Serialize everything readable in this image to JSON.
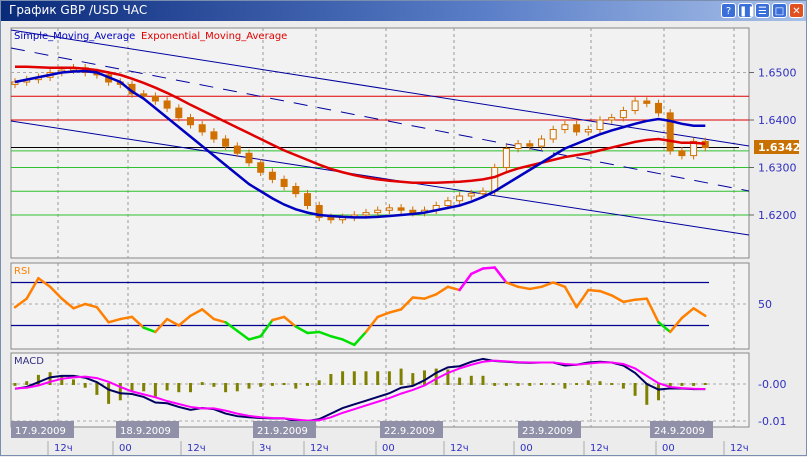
{
  "window": {
    "title": "График GBP /USD  ЧАС",
    "buttons": [
      "?",
      "❚❚",
      "☰",
      "□",
      "✕"
    ]
  },
  "colors": {
    "candle": "#d07000",
    "sma": "#0000c0",
    "ema": "#e00000",
    "rsi": "#ff8000",
    "rsi_high": "#ff00ff",
    "rsi_low": "#00e000",
    "macd": "#000060",
    "signal": "#ff00ff",
    "hist": "#808000",
    "current_bg": "#c87000"
  },
  "chart_data": [
    {
      "type": "candlestick",
      "title": "GBP/USD",
      "legend": [
        "Simple_Moving_Average",
        "Exponential_Moving_Average"
      ],
      "y_ticks": [
        "1.6500",
        "1.6400",
        "1.6300",
        "1.6200"
      ],
      "y_tick_values": [
        1.65,
        1.64,
        1.63,
        1.62
      ],
      "current_price": "1.6342",
      "current_value": 1.6342,
      "red_levels": [
        1.645,
        1.64
      ],
      "green_levels": [
        1.6335,
        1.63,
        1.625,
        1.62
      ],
      "closes": [
        1.648,
        1.6485,
        1.649,
        1.65,
        1.6505,
        1.651,
        1.65,
        1.6495,
        1.648,
        1.6475,
        1.6455,
        1.645,
        1.644,
        1.6425,
        1.6405,
        1.639,
        1.6375,
        1.636,
        1.6345,
        1.633,
        1.631,
        1.629,
        1.6275,
        1.626,
        1.6245,
        1.622,
        1.6195,
        1.619,
        1.6195,
        1.62,
        1.6205,
        1.621,
        1.6215,
        1.621,
        1.6205,
        1.621,
        1.622,
        1.623,
        1.624,
        1.6245,
        1.625,
        1.63,
        1.634,
        1.635,
        1.6345,
        1.636,
        1.638,
        1.639,
        1.6375,
        1.638,
        1.64,
        1.6405,
        1.642,
        1.644,
        1.6435,
        1.6415,
        1.6335,
        1.6325,
        1.6355,
        1.6342
      ],
      "sma": [
        1.648,
        1.6485,
        1.649,
        1.6495,
        1.65,
        1.6502,
        1.6503,
        1.65,
        1.649,
        1.648,
        1.646,
        1.6445,
        1.6425,
        1.6405,
        1.6385,
        1.6365,
        1.6345,
        1.6325,
        1.6305,
        1.6285,
        1.6265,
        1.625,
        1.6235,
        1.6222,
        1.6212,
        1.6205,
        1.62,
        1.6198,
        1.6196,
        1.6195,
        1.6195,
        1.6196,
        1.6198,
        1.62,
        1.6202,
        1.6205,
        1.621,
        1.6215,
        1.622,
        1.6228,
        1.6238,
        1.625,
        1.6265,
        1.628,
        1.6295,
        1.631,
        1.6325,
        1.634,
        1.635,
        1.636,
        1.637,
        1.6378,
        1.6385,
        1.6392,
        1.6398,
        1.6402,
        1.6398,
        1.6392,
        1.6388,
        1.6388
      ],
      "ema": [
        1.6512,
        1.6512,
        1.6511,
        1.651,
        1.651,
        1.651,
        1.6508,
        1.6505,
        1.65,
        1.6495,
        1.6487,
        1.6478,
        1.6468,
        1.6457,
        1.6445,
        1.6432,
        1.642,
        1.6408,
        1.6396,
        1.6384,
        1.6372,
        1.636,
        1.6348,
        1.6336,
        1.6326,
        1.6316,
        1.6306,
        1.6297,
        1.629,
        1.6284,
        1.6279,
        1.6275,
        1.6272,
        1.627,
        1.6268,
        1.6268,
        1.6268,
        1.6269,
        1.627,
        1.6272,
        1.6275,
        1.628,
        1.629,
        1.6298,
        1.6304,
        1.631,
        1.6316,
        1.6322,
        1.6326,
        1.633,
        1.6336,
        1.6342,
        1.6348,
        1.6354,
        1.6358,
        1.636,
        1.6356,
        1.6352,
        1.6352,
        1.635
      ]
    },
    {
      "type": "line",
      "title": "RSI",
      "y_ticks": [
        "50"
      ],
      "levels": [
        70,
        30
      ],
      "values": [
        47,
        55,
        74,
        66,
        55,
        46,
        50,
        47,
        33,
        36,
        38,
        28,
        24,
        36,
        30,
        39,
        45,
        36,
        33,
        25,
        17,
        20,
        35,
        38,
        29,
        23,
        24,
        20,
        17,
        12,
        24,
        38,
        42,
        45,
        56,
        55,
        59,
        66,
        63,
        78,
        83,
        84,
        70,
        66,
        64,
        66,
        70,
        66,
        47,
        63,
        62,
        58,
        52,
        54,
        55,
        33,
        24,
        37,
        46,
        39
      ]
    },
    {
      "type": "line",
      "title": "MACD",
      "y_ticks": [
        "-0.00",
        "-0.01"
      ],
      "main": [
        -0.0013,
        -0.0008,
        0.0005,
        0.0018,
        0.0022,
        0.0022,
        0.0017,
        0.0005,
        -0.0015,
        -0.0025,
        -0.0027,
        -0.0035,
        -0.005,
        -0.0052,
        -0.0062,
        -0.007,
        -0.0065,
        -0.0068,
        -0.008,
        -0.0087,
        -0.009,
        -0.0092,
        -0.0093,
        -0.0093,
        -0.01,
        -0.01,
        -0.0095,
        -0.008,
        -0.0065,
        -0.0055,
        -0.0045,
        -0.0035,
        -0.0025,
        -0.001,
        -0.0005,
        0.001,
        0.003,
        0.0045,
        0.0048,
        0.006,
        0.0068,
        0.0062,
        0.006,
        0.0058,
        0.0057,
        0.0058,
        0.0058,
        0.005,
        0.0052,
        0.0058,
        0.006,
        0.0058,
        0.005,
        0.003,
        0.0,
        -0.0015,
        -0.0012,
        -0.0012,
        -0.0014,
        -0.0014
      ],
      "signal": [
        -0.0012,
        -0.001,
        -0.0004,
        0.0006,
        0.0014,
        0.0018,
        0.002,
        0.0016,
        0.0006,
        -0.0008,
        -0.002,
        -0.0028,
        -0.0036,
        -0.0046,
        -0.0054,
        -0.0062,
        -0.0066,
        -0.0066,
        -0.0072,
        -0.008,
        -0.0086,
        -0.009,
        -0.0092,
        -0.0093,
        -0.0096,
        -0.0099,
        -0.0098,
        -0.009,
        -0.0078,
        -0.0068,
        -0.0058,
        -0.0048,
        -0.0038,
        -0.0026,
        -0.0016,
        -0.0004,
        0.0014,
        0.003,
        0.0042,
        0.0052,
        0.006,
        0.0063,
        0.0061,
        0.0059,
        0.0058,
        0.0058,
        0.0058,
        0.0054,
        0.0052,
        0.0055,
        0.0058,
        0.0058,
        0.0054,
        0.0042,
        0.0022,
        0.0002,
        -0.0008,
        -0.0011,
        -0.0013,
        -0.0014
      ]
    },
    {
      "type": "axis",
      "dates": [
        "17.9.2009",
        "18.9.2009",
        "21.9.2009",
        "22.9.2009",
        "23.9.2009",
        "24.9.2009"
      ],
      "hours": [
        "12ч",
        "00",
        "12ч",
        "3ч",
        "12ч",
        "00",
        "12ч",
        "00",
        "12ч",
        "00",
        "12ч"
      ]
    }
  ]
}
